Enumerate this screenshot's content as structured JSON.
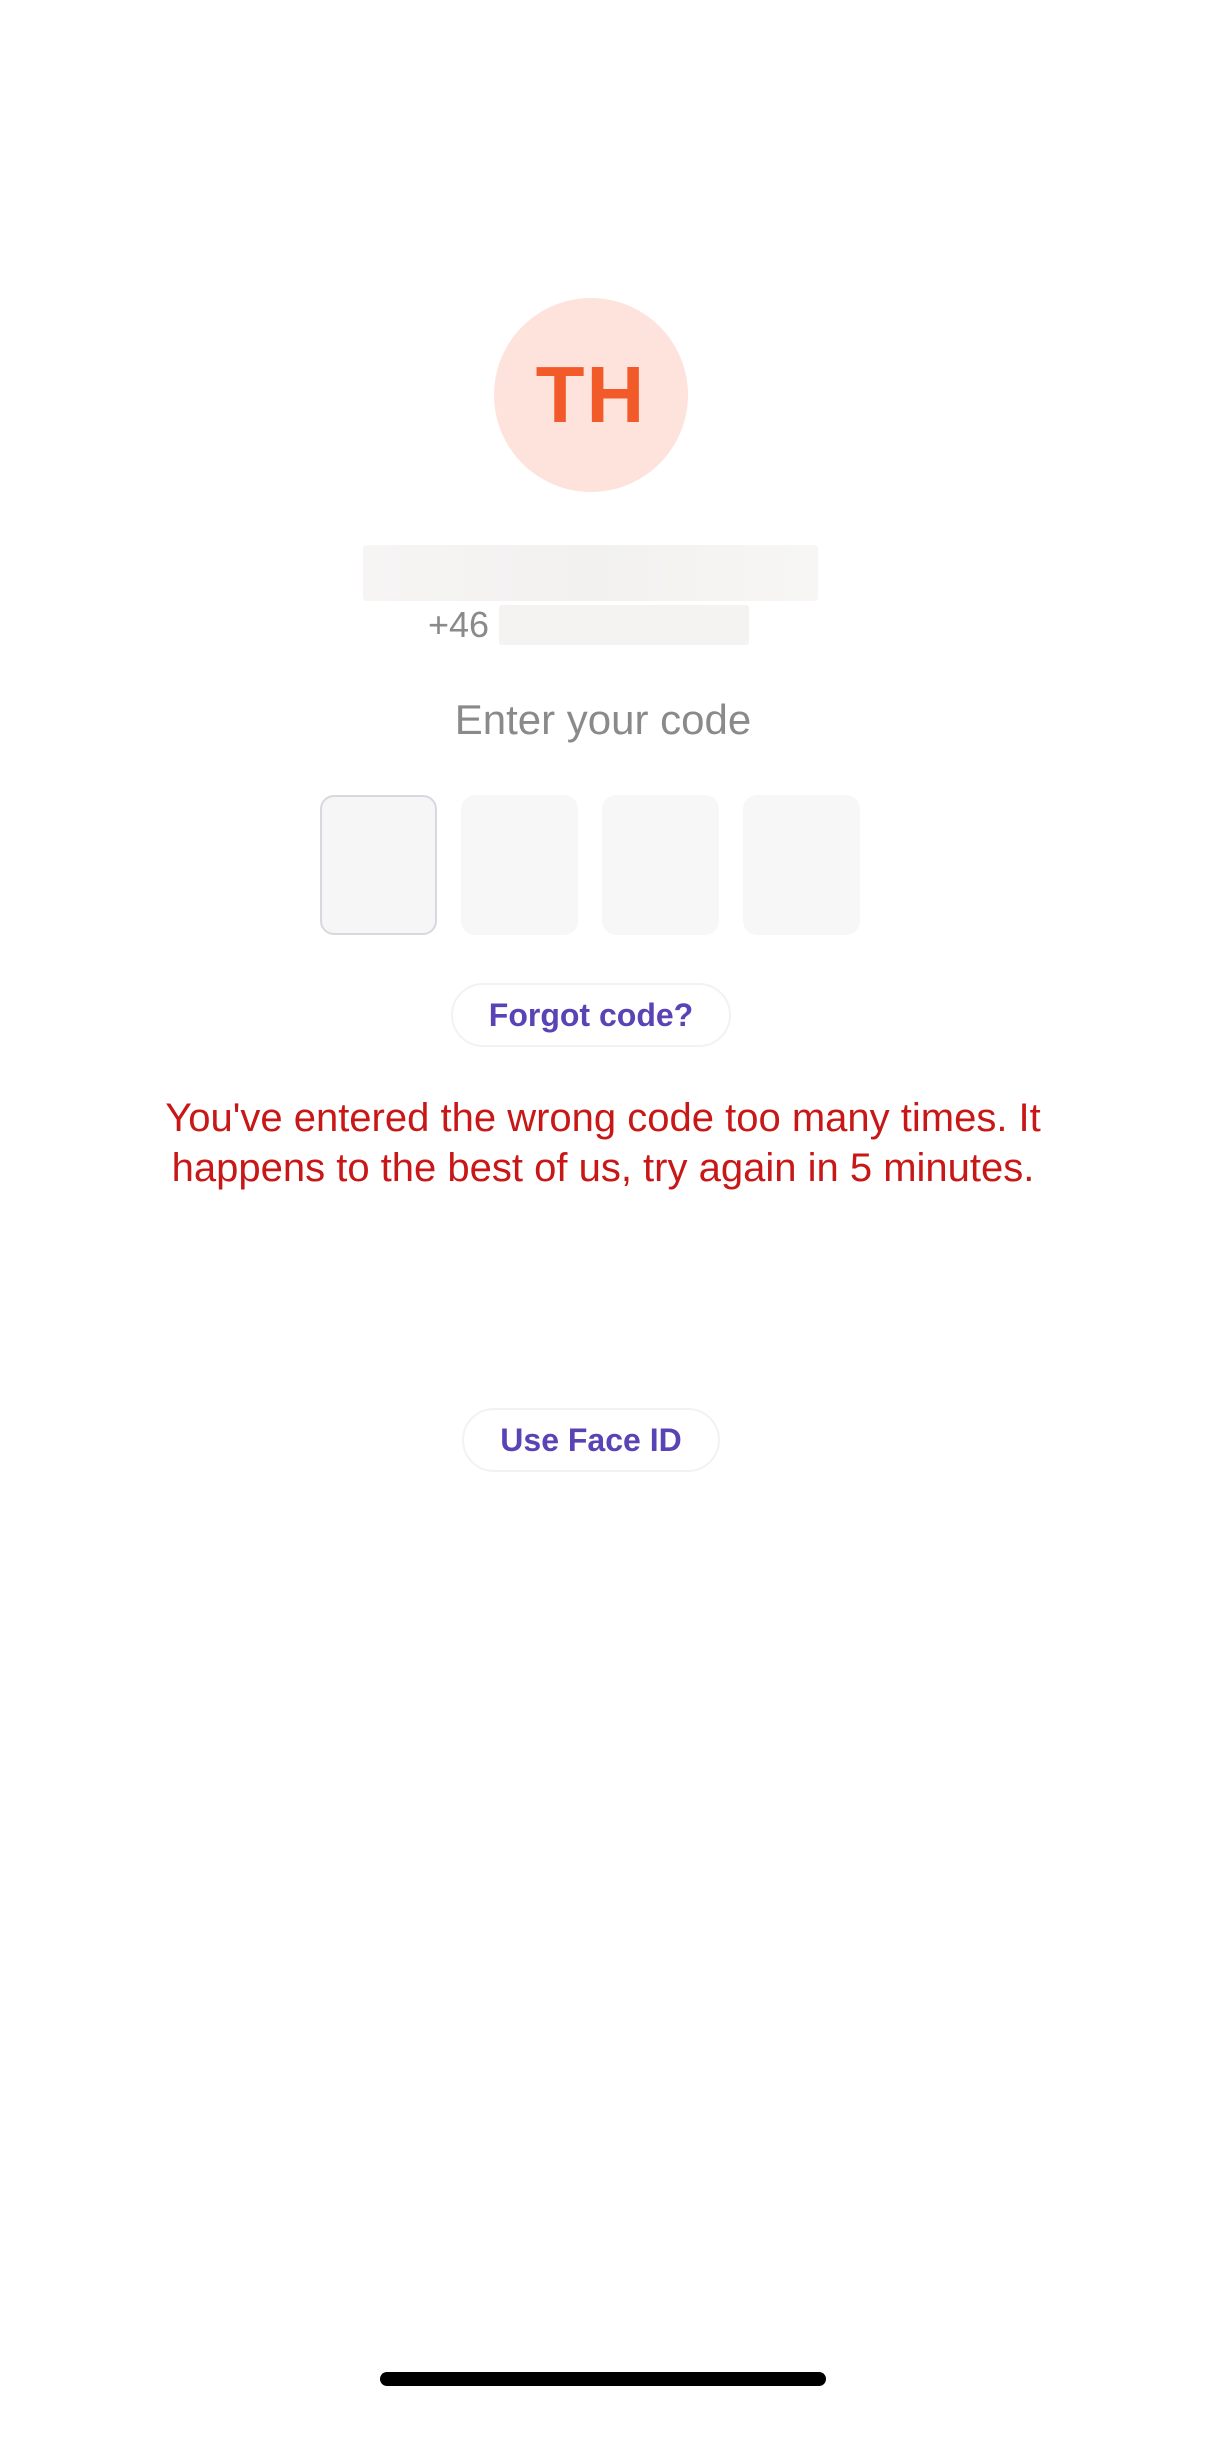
{
  "profile": {
    "initials": "TH",
    "phone_prefix": "+46"
  },
  "code_prompt": "Enter your code",
  "code_boxes": [
    "",
    "",
    "",
    ""
  ],
  "actions": {
    "forgot_code": "Forgot code?",
    "use_face_id": "Use Face ID"
  },
  "error_message": {
    "line1": "You've entered the wrong code too many times. It",
    "line2": "happens to the best of us, try again in 5 minutes."
  },
  "colors": {
    "avatar_bg": "#fde3db",
    "avatar_text": "#f35a2a",
    "link": "#5a43b5",
    "error": "#c81717",
    "muted_text": "#8a8a8a"
  }
}
